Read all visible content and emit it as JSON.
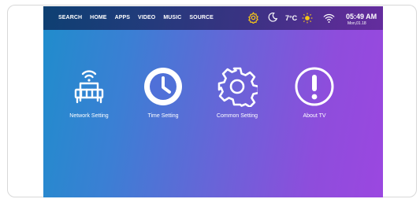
{
  "menu": {
    "items": [
      "SEARCH",
      "HOME",
      "APPS",
      "VIDEO",
      "MUSIC",
      "SOURCE"
    ]
  },
  "status": {
    "temperature": "7°C",
    "time": "05:49 AM",
    "date": "Mon,01.18",
    "icons": [
      "settings-gear-icon",
      "weather-moon-icon",
      "weather-sun-icon",
      "wifi-icon"
    ]
  },
  "settings": {
    "tiles": [
      {
        "label": "Network Setting",
        "icon": "router-icon"
      },
      {
        "label": "Time Setting",
        "icon": "clock-icon"
      },
      {
        "label": "Common Setting",
        "icon": "gear-icon"
      },
      {
        "label": "About TV",
        "icon": "info-exclamation-icon"
      }
    ]
  },
  "colors": {
    "accent_gear": "#f5c518",
    "sun": "#f5c518",
    "gradient_start": "#1f8dcc",
    "gradient_end": "#9b47e0"
  }
}
